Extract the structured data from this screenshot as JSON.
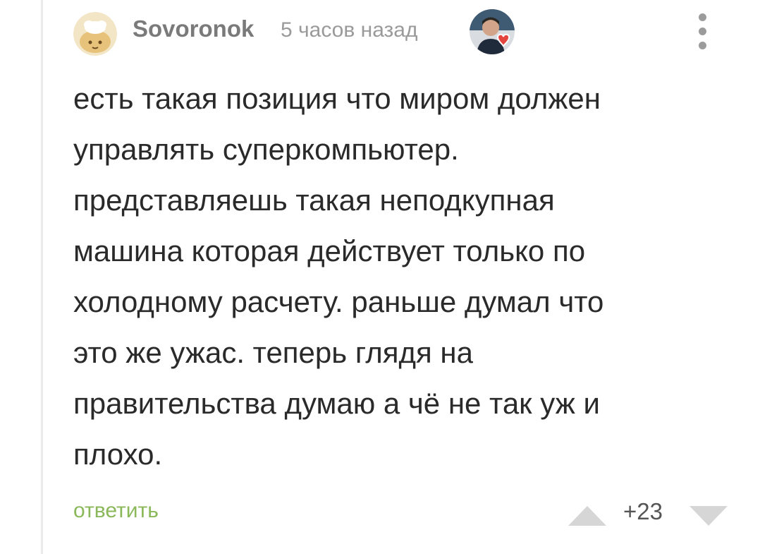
{
  "comment": {
    "author": "Sovoronok",
    "timestamp": "5 часов назад",
    "body_lines": [
      "есть такая позиция что миром должен",
      "управлять суперкомпьютер.",
      "представляешь такая неподкупная",
      "машина которая действует только по",
      "холодному расчету. раньше думал что",
      "это же ужас. теперь глядя на",
      "правительства думаю а чё не так уж и",
      "плохо."
    ],
    "reply_label": "ответить",
    "rating": "+23"
  },
  "icons": {
    "avatar": "cartoon-cat-avatar",
    "badge": "user-photo-heart-badge",
    "menu": "kebab-menu-icon",
    "vote_up": "triangle-up-icon",
    "vote_down": "triangle-down-icon"
  },
  "colors": {
    "reply": "#8ab85a",
    "text": "#2a2a2a",
    "meta": "#9a9a9a",
    "vote_arrow": "#d6d6d6",
    "heart": "#e4463f"
  }
}
